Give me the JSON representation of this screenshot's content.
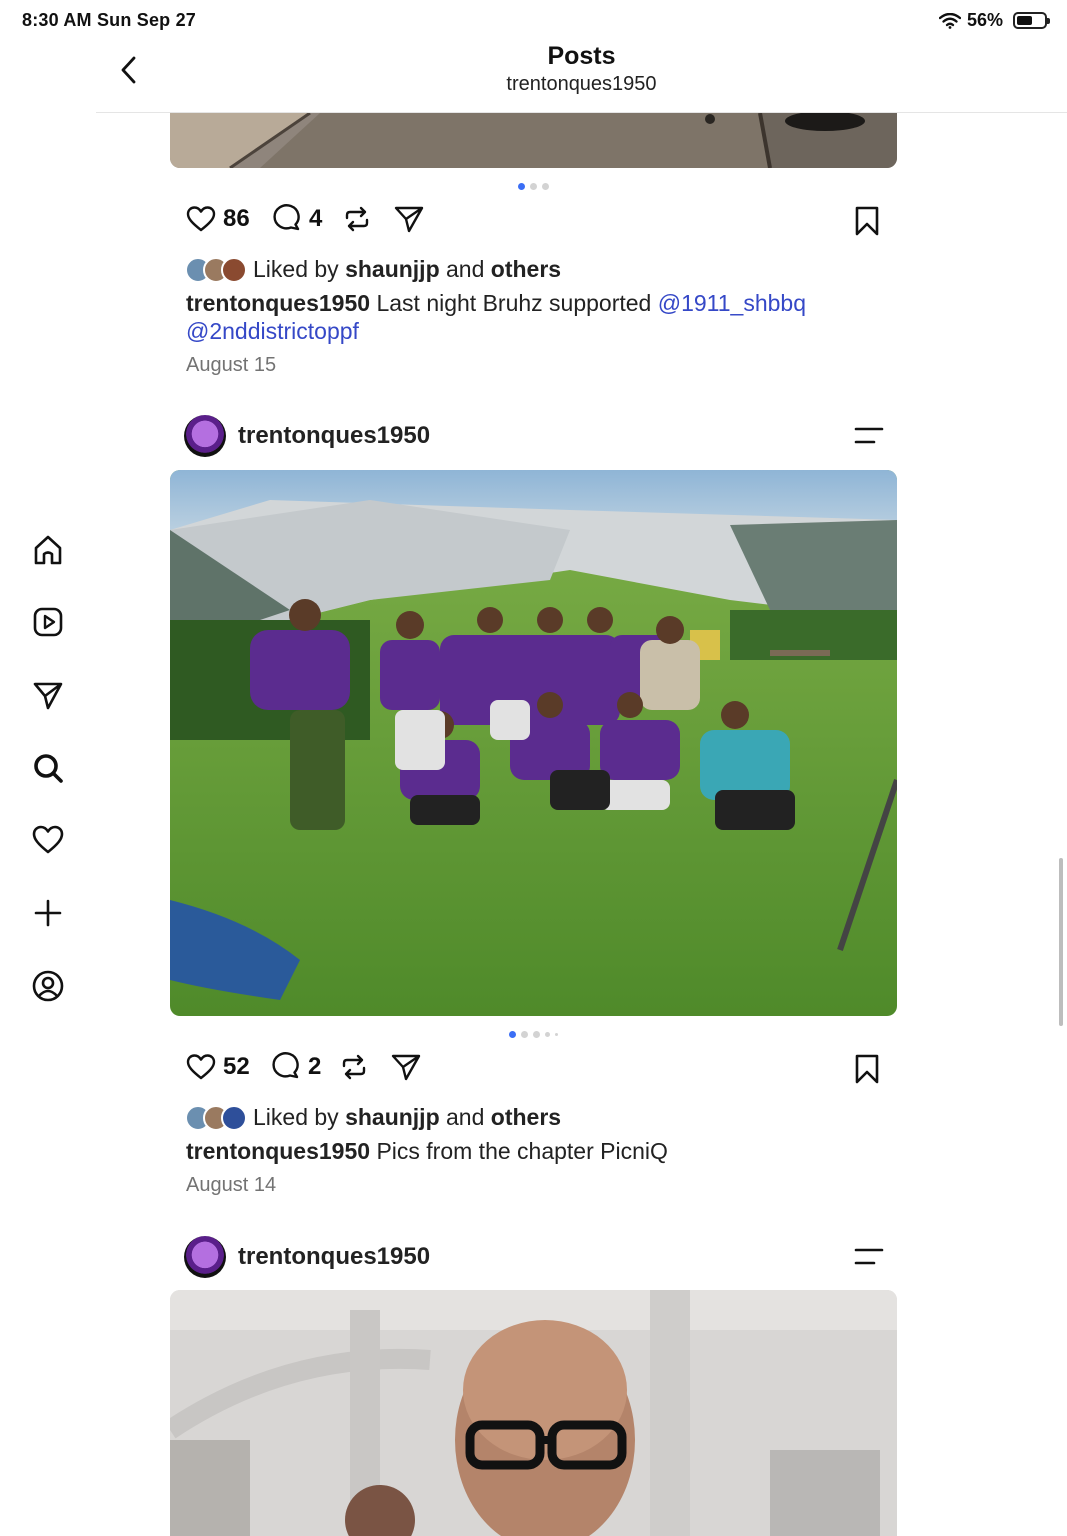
{
  "status_bar": {
    "time": "8:30 AM  Sun Sep 27",
    "battery_text": "56%",
    "battery_level": 0.56
  },
  "header": {
    "title": "Posts",
    "subtitle": "trentonques1950"
  },
  "nav": {
    "items": [
      "home-icon",
      "reels-icon",
      "send-icon",
      "search-icon",
      "heart-icon",
      "create-icon",
      "profile-icon"
    ]
  },
  "posts": [
    {
      "likes": "86",
      "comments": "4",
      "liked_by_prefix": "Liked by",
      "liked_by_user": "shaunjjp",
      "liked_by_and": "and",
      "liked_by_others": "others",
      "username": "trentonques1950",
      "caption_text": " Last night Bruhz supported ",
      "mention1": "@1911_shbbq",
      "mention2": "@2nddistrictoppf",
      "date": "August 15",
      "carousel_count": 3,
      "carousel_index": 1
    },
    {
      "username": "trentonques1950",
      "likes": "52",
      "comments": "2",
      "liked_by_prefix": "Liked by",
      "liked_by_user": "shaunjjp",
      "liked_by_and": "and",
      "liked_by_others": "others",
      "caption_text": " Pics from the chapter PicniQ",
      "date": "August 14",
      "carousel_count": 5,
      "carousel_index": 1
    },
    {
      "username": "trentonques1950"
    }
  ],
  "colors": {
    "accent": "#3b6ef5",
    "mention": "#3548c7",
    "muted": "#737373"
  }
}
